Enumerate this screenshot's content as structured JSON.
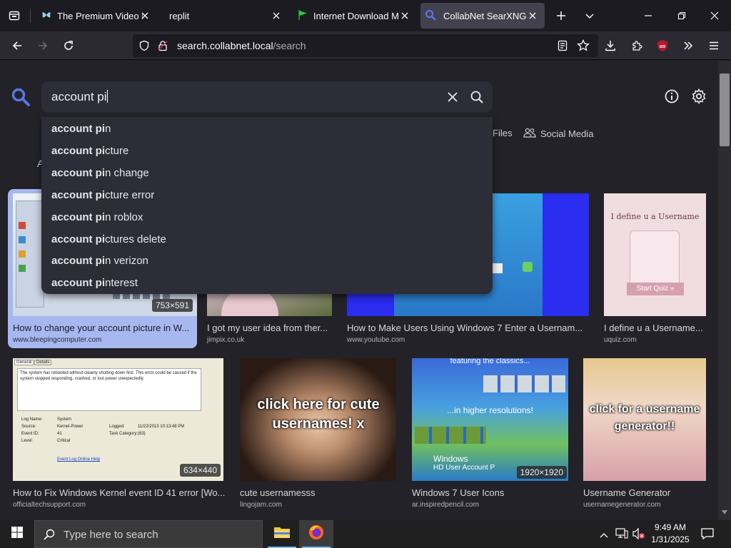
{
  "browser": {
    "tabs": [
      {
        "title": "The Premium Video Ma",
        "active": false
      },
      {
        "title": "replit",
        "active": false
      },
      {
        "title": "Internet Download Ma",
        "active": false
      },
      {
        "title": "CollabNet SearXNG",
        "active": true
      }
    ],
    "url_host": "search.collabnet.local",
    "url_path": "/search"
  },
  "search": {
    "query": "account pi",
    "suggestions": [
      {
        "bold": "account pi",
        "rest": "n"
      },
      {
        "bold": "account pi",
        "rest": "cture"
      },
      {
        "bold": "account pi",
        "rest": "n change"
      },
      {
        "bold": "account pi",
        "rest": "cture error"
      },
      {
        "bold": "account pi",
        "rest": "n roblox"
      },
      {
        "bold": "account pi",
        "rest": "ctures delete"
      },
      {
        "bold": "account pi",
        "rest": "n verizon"
      },
      {
        "bold": "account pi",
        "rest": "nterest"
      }
    ]
  },
  "categories": {
    "files": "Files",
    "social": "Social Media",
    "partial_all": "A"
  },
  "results": [
    {
      "title": "How to change your account picture in W...",
      "source": "www.bleepingcomputer.com",
      "resolution": "753×591"
    },
    {
      "title": "I got my user idea from ther...",
      "source": "jimpix.co.uk",
      "resolution": ""
    },
    {
      "title": "How to Make Users Using Windows 7 Enter a Usernam...",
      "source": "www.youtube.com",
      "resolution": ""
    },
    {
      "title": "I define u a Username...",
      "source": "uquiz.com",
      "resolution": ""
    },
    {
      "title": "How to Fix Windows Kernel event ID 41 error [Wo...",
      "source": "officialtechsupport.com",
      "resolution": "634×440"
    },
    {
      "title": "cute usernamesss",
      "source": "lingojam.com",
      "resolution": ""
    },
    {
      "title": "Windows 7 User Icons",
      "source": "ar.inspiredpencil.com",
      "resolution": "1920×1920"
    },
    {
      "title": "Username Generator",
      "source": "usernamegenerator.com",
      "resolution": ""
    }
  ],
  "thumb_text": {
    "quiz": "I define u a Username",
    "quiz_btn": "Start Quiz »",
    "cute": "click here for cute usernames! x",
    "win7_top": "featuring the classics...",
    "win7_mid": "...in higher resolutions!",
    "win7_logo": "Windows",
    "win7_sub": "HD User Account P",
    "gen": "click for a username generator!!",
    "event_head": "The system has rebooted without cleanly shutting down first. This error could be caused if the system stopped responding, crashed, or lost power unexpectedly.",
    "event_log_name": "Log Name:",
    "event_log_val": "System",
    "event_source": "Source:",
    "event_source_val": "Kernel-Power",
    "event_id": "Event ID:",
    "event_id_val": "41",
    "event_level": "Level:",
    "event_level_val": "Critical",
    "event_logged": "Logged:",
    "event_logged_val": "11/22/2013 10:13:48 PM",
    "event_task": "Task Category:",
    "event_task_val": "(63)",
    "event_link": "Event Log Online Help",
    "tab_general": "General",
    "tab_details": "Details"
  },
  "taskbar": {
    "search_placeholder": "Type here to search",
    "time": "9:49 AM",
    "date": "1/31/2025"
  },
  "colors": {
    "accent": "#6c8cff",
    "selected_card": "#a7b8f0",
    "page_bg": "#222228"
  }
}
